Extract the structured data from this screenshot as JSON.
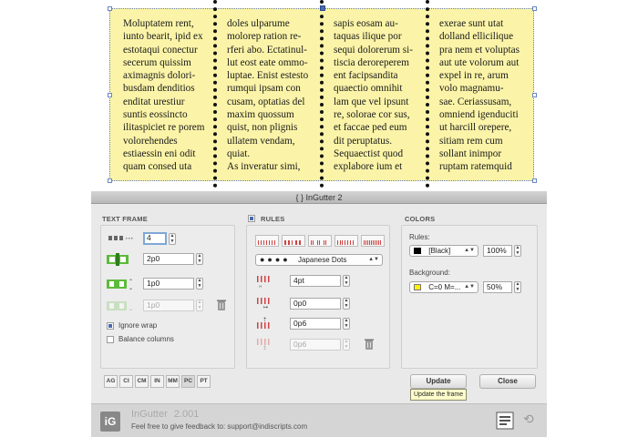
{
  "document": {
    "columns": [
      [
        "Moluptatem rent,",
        "iunto bearit, ipid ex",
        "estotaqui conectur",
        "secerum quissim",
        "aximagnis dolori-",
        "busdam denditios",
        "enditat urestiur",
        "suntis eossincto",
        "ilitaspiciet re porem",
        "volorehendes",
        "estiaessin eni odit",
        "quam consed uta"
      ],
      [
        "doles ulparume",
        "molorep ration re-",
        "rferi abo. Ectatinul-",
        "lut eost eate ommo-",
        "luptae. Enist estesto",
        "rumqui ipsam con",
        "cusam, optatias del",
        "maxim quossum",
        "quist, non plignis",
        "ullatem vendam,",
        "quiat.",
        "As inveratur simi,"
      ],
      [
        "sapis eosam au-",
        "taquas ilique por",
        "sequi dolorerum si-",
        "tiscia deroreperem",
        "ent facipsandita",
        "quaectio omnihit",
        "lam que vel ipsunt",
        "re, solorae cor sus,",
        "et faccae ped eum",
        "dit peruptatus.",
        "Sequaectist quod",
        "explabore ium et"
      ],
      [
        "exerae sunt utat",
        "dolland ellicilique",
        "pra nem et voluptas",
        "aut ute volorum aut",
        "expel in re, arum",
        "volo magnamu-",
        "sae. Ceriassusam,",
        "omniend igenduciti",
        "ut harcill orepere,",
        "sitiam rem cum",
        "sollant inimpor",
        "ruptam ratemquid"
      ]
    ],
    "frame_color": "#fbf4a8",
    "rule_color": "#111111"
  },
  "palette": {
    "title_icon": "braces-icon",
    "title": "InGutter 2",
    "text_frame": {
      "heading": "TEXT FRAME",
      "columns_value": "4",
      "gutter_value": "2p0",
      "inset_value": "1p0",
      "inset2_value": "1p0",
      "ignore_wrap_label": "Ignore wrap",
      "ignore_wrap_checked": true,
      "balance_columns_label": "Balance columns",
      "balance_columns_checked": false
    },
    "rules": {
      "heading": "RULES",
      "checked": true,
      "style_select": "Japanese Dots",
      "weight_value": "4pt",
      "offset_top_value": "0p0",
      "offset_bottom_value": "0p6",
      "offset_disabled_value": "0p6"
    },
    "colors": {
      "heading": "COLORS",
      "rules_label": "Rules:",
      "rules_color_select": "[Black]",
      "rules_swatch": "#000000",
      "rules_tint": "100%",
      "background_label": "Background:",
      "background_color_select": "C=0 M=...",
      "background_swatch": "#fff200",
      "background_tint": "50%"
    },
    "units": [
      "AG",
      "CI",
      "CM",
      "IN",
      "MM",
      "PC",
      "PT"
    ],
    "update_button": "Update",
    "update_tooltip": "Update the frame",
    "close_button": "Close",
    "footer": {
      "logo": "iG",
      "product": "InGutter",
      "version": "2.001",
      "feedback": "Feel free to give feedback to: support@indiscripts.com"
    }
  }
}
